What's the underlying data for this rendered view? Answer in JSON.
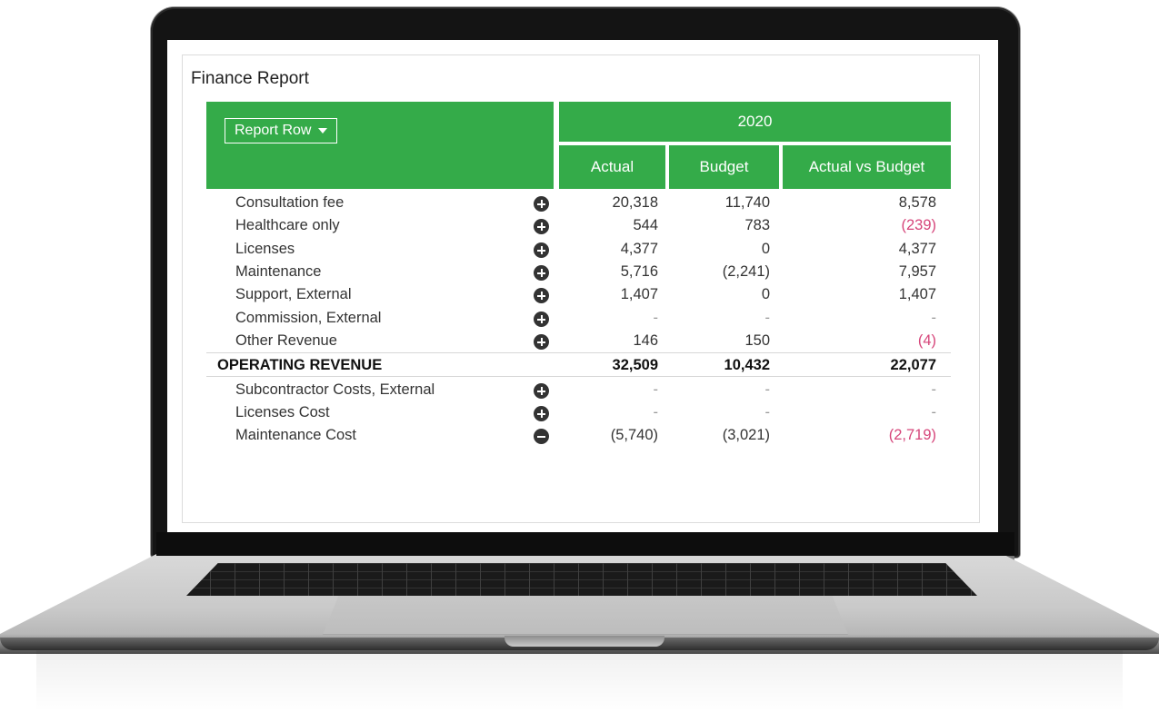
{
  "report": {
    "title": "Finance Report",
    "row_selector": "Report Row",
    "year": "2020",
    "columns": [
      "Actual",
      "Budget",
      "Actual vs Budget"
    ]
  },
  "rows": [
    {
      "label": "Consultation fee",
      "toggle": "expand",
      "actual": "20,318",
      "budget": "11,740",
      "variance": "8,578"
    },
    {
      "label": "Healthcare only",
      "toggle": "expand",
      "actual": "544",
      "budget": "783",
      "variance": "(239)"
    },
    {
      "label": "Licenses",
      "toggle": "expand",
      "actual": "4,377",
      "budget": "0",
      "variance": "4,377"
    },
    {
      "label": "Maintenance",
      "toggle": "expand",
      "actual": "5,716",
      "budget": "(2,241)",
      "variance": "7,957"
    },
    {
      "label": "Support, External",
      "toggle": "expand",
      "actual": "1,407",
      "budget": "0",
      "variance": "1,407"
    },
    {
      "label": "Commission, External",
      "toggle": "expand",
      "actual": "-",
      "budget": "-",
      "variance": "-"
    },
    {
      "label": "Other Revenue",
      "toggle": "expand",
      "actual": "146",
      "budget": "150",
      "variance": "(4)"
    },
    {
      "label": "OPERATING REVENUE",
      "total": true,
      "actual": "32,509",
      "budget": "10,432",
      "variance": "22,077"
    },
    {
      "label": "Subcontractor Costs, External",
      "toggle": "expand",
      "actual": "-",
      "budget": "-",
      "variance": "-"
    },
    {
      "label": "Licenses Cost",
      "toggle": "expand",
      "actual": "-",
      "budget": "-",
      "variance": "-"
    },
    {
      "label": "Maintenance Cost",
      "toggle": "collapse",
      "actual": "(5,740)",
      "budget": "(3,021)",
      "variance": "(2,719)"
    }
  ],
  "colors": {
    "header_green": "#34ab49",
    "negative_variance": "#d6457a"
  }
}
